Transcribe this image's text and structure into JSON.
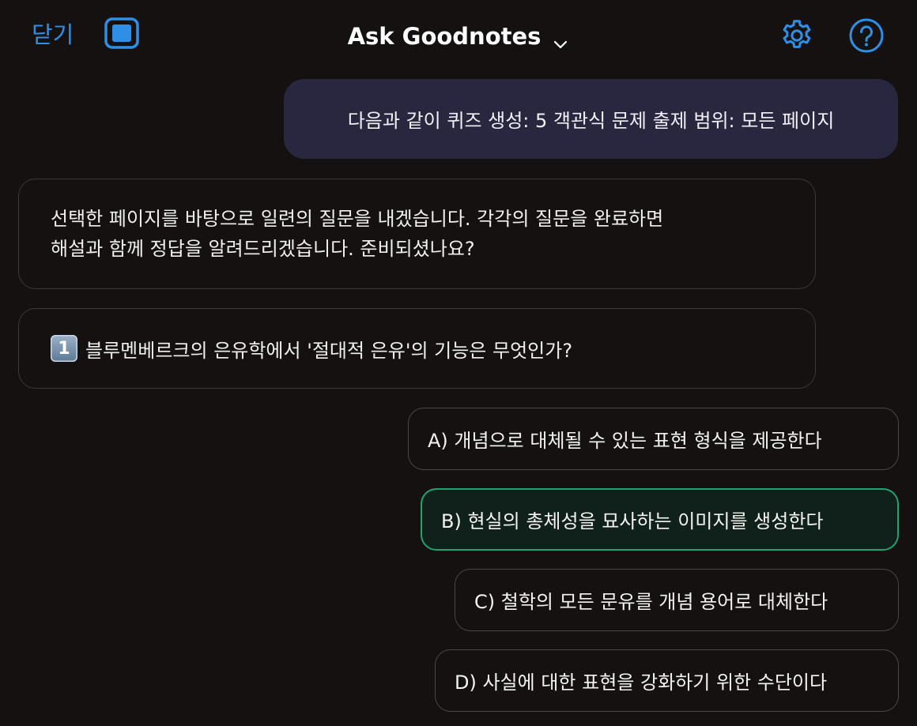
{
  "header": {
    "close_label": "닫기",
    "title": "Ask Goodnotes",
    "sidebar_icon": "sidebar-toggle-icon",
    "settings_icon": "gear-icon",
    "help_icon": "question-circle-icon",
    "accent_color": "#2f8fe6"
  },
  "conversation": {
    "user_message": "다음과 같이 퀴즈 생성: 5 객관식 문제 출제 범위: 모든 페이지",
    "assistant_intro_line1": "선택한 페이지를 바탕으로 일련의 질문을 내겠습니다. 각각의 질문을 완료하면",
    "assistant_intro_line2": "해설과 함께 정답을 알려드리겠습니다. 준비되셨나요?",
    "question": {
      "number": "1",
      "text": "블루멘베르크의 은유학에서 '절대적 은유'의 기능은 무엇인가?"
    },
    "options": [
      {
        "label": "A) 개념으로 대체될 수 있는 표현 형식을 제공한다",
        "selected": false
      },
      {
        "label": "B) 현실의 총체성을 묘사하는 이미지를 생성한다",
        "selected": true
      },
      {
        "label": "C) 철학의 모든 문유를 개념 용어로 대체한다",
        "selected": false
      },
      {
        "label": "D) 사실에 대한 표현을 강화하기 위한 수단이다",
        "selected": false
      }
    ]
  },
  "colors": {
    "background": "#141110",
    "user_bubble": "#292740",
    "selected_border": "#1fa36f"
  }
}
